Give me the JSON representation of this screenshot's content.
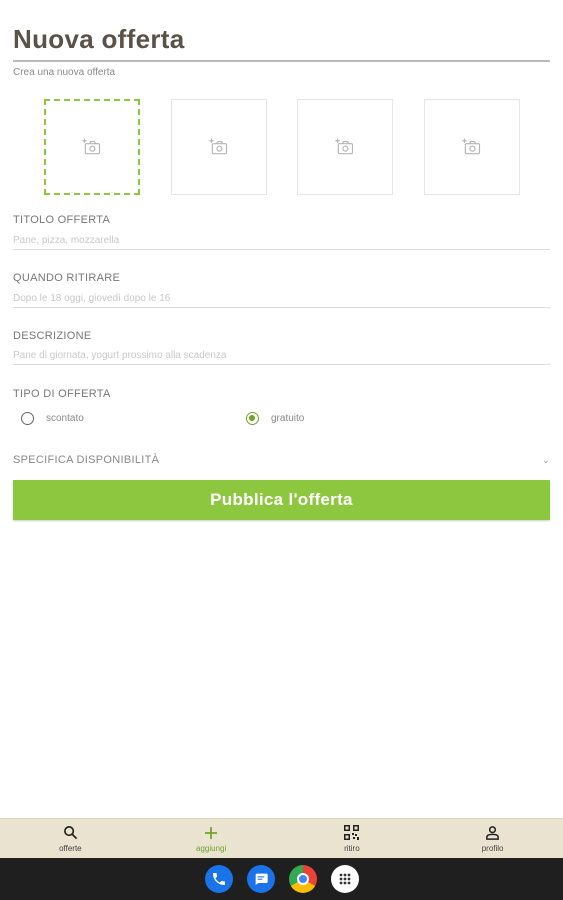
{
  "header": {
    "title": "Nuova offerta",
    "subtitle": "Crea una nuova offerta"
  },
  "photos": {
    "slots": [
      {
        "icon": "add-photo-icon",
        "active": true
      },
      {
        "icon": "add-photo-icon",
        "active": false
      },
      {
        "icon": "add-photo-icon",
        "active": false
      },
      {
        "icon": "add-photo-icon",
        "active": false
      }
    ]
  },
  "form": {
    "title": {
      "label": "TITOLO OFFERTA",
      "value": "",
      "placeholder": "Pane, pizza, mozzarella"
    },
    "pickup": {
      "label": "QUANDO RITIRARE",
      "value": "",
      "placeholder": "Dopo le 18 oggi, giovedì dopo le 16"
    },
    "description": {
      "label": "DESCRIZIONE",
      "value": "",
      "placeholder": "Pane di giornata, yogurt prossimo alla scadenza"
    },
    "offer_type": {
      "label": "TIPO DI OFFERTA",
      "options": [
        {
          "label": "scontato",
          "checked": false
        },
        {
          "label": "gratuito",
          "checked": true
        }
      ]
    },
    "availability": {
      "label": "SPECIFICA DISPONIBILITÀ",
      "icon": "chevron-down-icon"
    },
    "submit_label": "Pubblica l'offerta"
  },
  "nav": {
    "items": [
      {
        "label": "offerte",
        "icon": "search-icon",
        "active": false
      },
      {
        "label": "aggiungi",
        "icon": "plus-icon",
        "active": true
      },
      {
        "label": "ritiro",
        "icon": "qr-code-icon",
        "active": false
      },
      {
        "label": "profilo",
        "icon": "person-icon",
        "active": false
      }
    ]
  },
  "dock": {
    "apps": [
      "phone-icon",
      "messages-icon",
      "chrome-icon",
      "app-drawer-icon"
    ]
  },
  "colors": {
    "accent": "#8dc63f",
    "title": "#5a5248",
    "nav_background": "#e9e3cf",
    "system_bar": "#1f1f1f"
  }
}
